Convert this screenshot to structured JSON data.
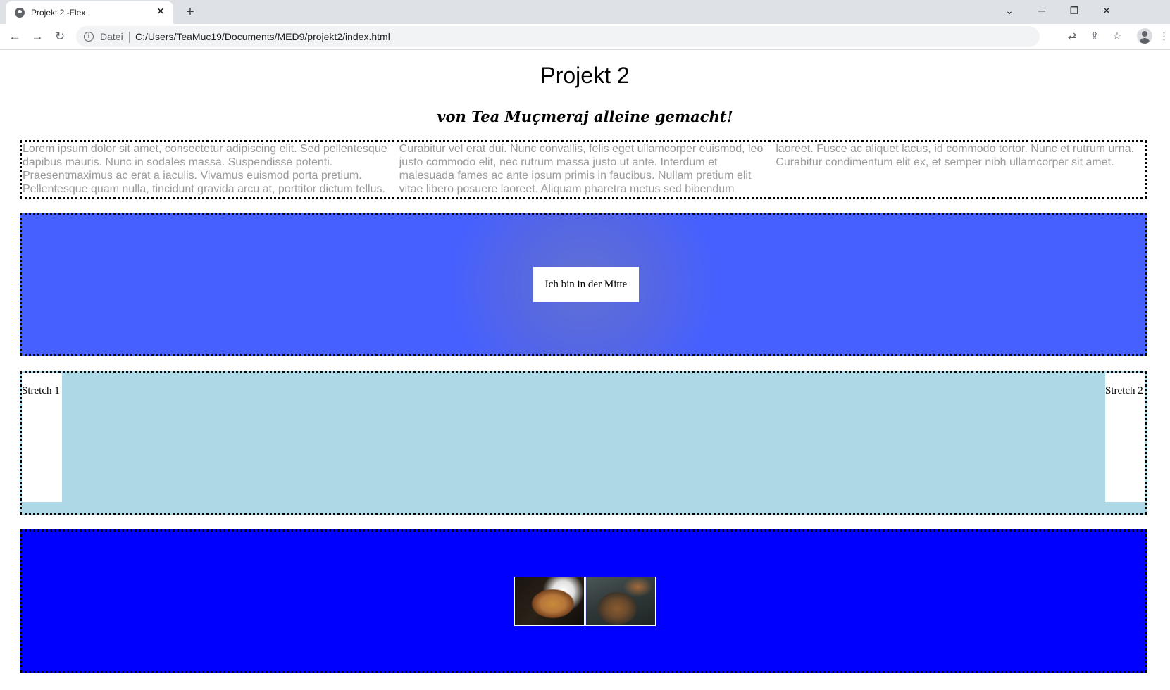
{
  "browser": {
    "tab_title": "Projekt 2 -Flex",
    "tab_close": "✕",
    "new_tab": "+",
    "omnibox_scheme_label": "Datei",
    "url": "C:/Users/TeaMuc19/Documents/MED9/projekt2/index.html",
    "window_controls": {
      "tab_search": "⌄",
      "minimize": "─",
      "restore": "❐",
      "close": "✕"
    }
  },
  "page": {
    "title": "Projekt 2",
    "subtitle": "von Tea Muçmeraj alleine gemacht!",
    "lorem_text": "Lorem ipsum dolor sit amet, consectetur adipiscing elit. Sed pellentesque dapibus mauris. Nunc in sodales massa. Suspendisse potenti. Praesentmaximus ac erat a iaculis. Vivamus euismod porta pretium. Pellentesque quam nulla, tincidunt gravida arcu at, porttitor dictum tellus. Curabitur vel erat dui. Nunc convallis, felis eget ullamcorper euismod, leo justo commodo elit, nec rutrum massa justo ut ante. Interdum et malesuada fames ac ante ipsum primis in faucibus. Nullam pretium elit vitae libero posuere laoreet. Aliquam pharetra metus sed bibendum laoreet. Fusce ac aliquet lacus, id commodo tortor. Nunc et rutrum urna. Curabitur condimentum elit ex, et semper nibh ullamcorper sit amet.",
    "center_box": "Ich bin in der Mitte",
    "stretch_1": "Stretch 1",
    "stretch_2": "Stretch 2",
    "images": [
      "pizza-image",
      "pizza-image"
    ]
  },
  "colors": {
    "center_section_bg": "#4660ff",
    "stretch_section_bg": "#add8e6",
    "image_section_bg": "#0000ff",
    "lorem_text": "#9a9a9a"
  }
}
